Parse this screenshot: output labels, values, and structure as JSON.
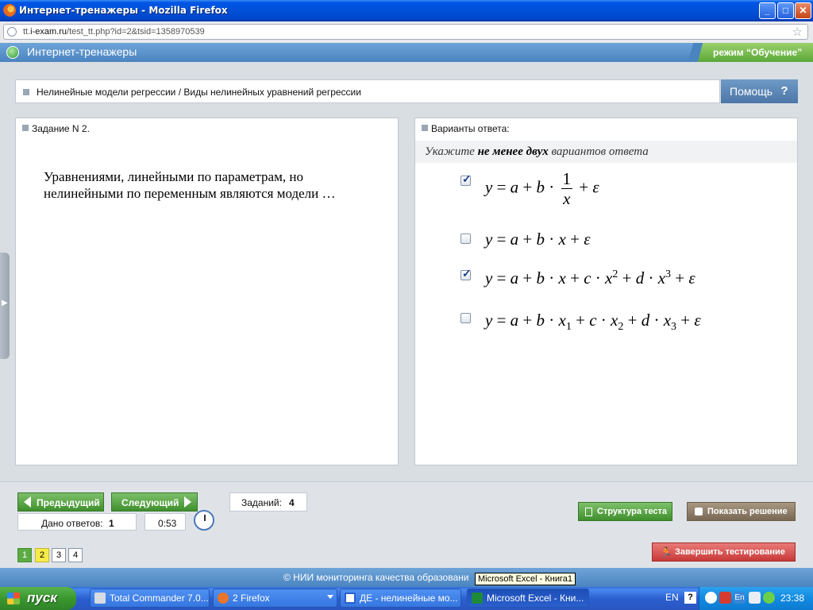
{
  "window": {
    "title": "Интернет-тренажеры - Mozilla Firefox",
    "buttons": {
      "minimize": "_",
      "maximize": "□",
      "close": "✕"
    }
  },
  "address": {
    "url_prefix": "tt.",
    "url_domain": "i-exam.ru",
    "url_rest": "/test_tt.php?id=2&tsid=1358970539"
  },
  "app": {
    "name": "Интернет-тренажеры",
    "mode": "режим “Обучение”"
  },
  "breadcrumb": "Нелинейные модели регрессии / Виды нелинейных уравнений регрессии",
  "help": {
    "label": "Помощь",
    "icon": "?"
  },
  "task": {
    "header": "Задание N 2.",
    "question": "Уравнениями, линейными по параметрам, но нелинейными по переменным являются модели …"
  },
  "answers": {
    "header": "Варианты ответа:",
    "hint_pre": "Укажите ",
    "hint_bold": "не менее двух",
    "hint_post": " вариантов ответа",
    "options": [
      {
        "checked": true,
        "formula": "y = a + b · 1/x + ε"
      },
      {
        "checked": false,
        "formula": "y = a + b · x + ε"
      },
      {
        "checked": true,
        "formula": "y = a + b · x + c · x² + d · x³ + ε"
      },
      {
        "checked": false,
        "formula": "y = a + b · x1 + c · x2 + d · x3 + ε"
      }
    ]
  },
  "nav": {
    "prev": "Предыдущий",
    "next": "Следующий",
    "tasks_label": "Заданий:",
    "tasks_count": "4",
    "answered_label": "Дано ответов:",
    "answered_count": "1",
    "timer": "0:53",
    "pages": [
      "1",
      "2",
      "3",
      "4"
    ]
  },
  "actions": {
    "structure": "Структура теста",
    "solution": "Показать решение",
    "finish": "Завершить тестирование"
  },
  "footer": "© НИИ мониторинга качества образовани",
  "tooltip": "Microsoft Excel - Книга1",
  "taskbar": {
    "start": "пуск",
    "items": [
      {
        "label": "Total Commander 7.0...",
        "color": "#d7dbe2"
      },
      {
        "label": "2 Firefox",
        "color": "#e8752a"
      },
      {
        "label": "ДЕ - нелинейные мо...",
        "color": "#2b5fcf"
      },
      {
        "label": "Microsoft Excel - Кни...",
        "color": "#1f8a3a"
      }
    ],
    "lang": "EN",
    "help": "?",
    "clock": "23:38"
  }
}
